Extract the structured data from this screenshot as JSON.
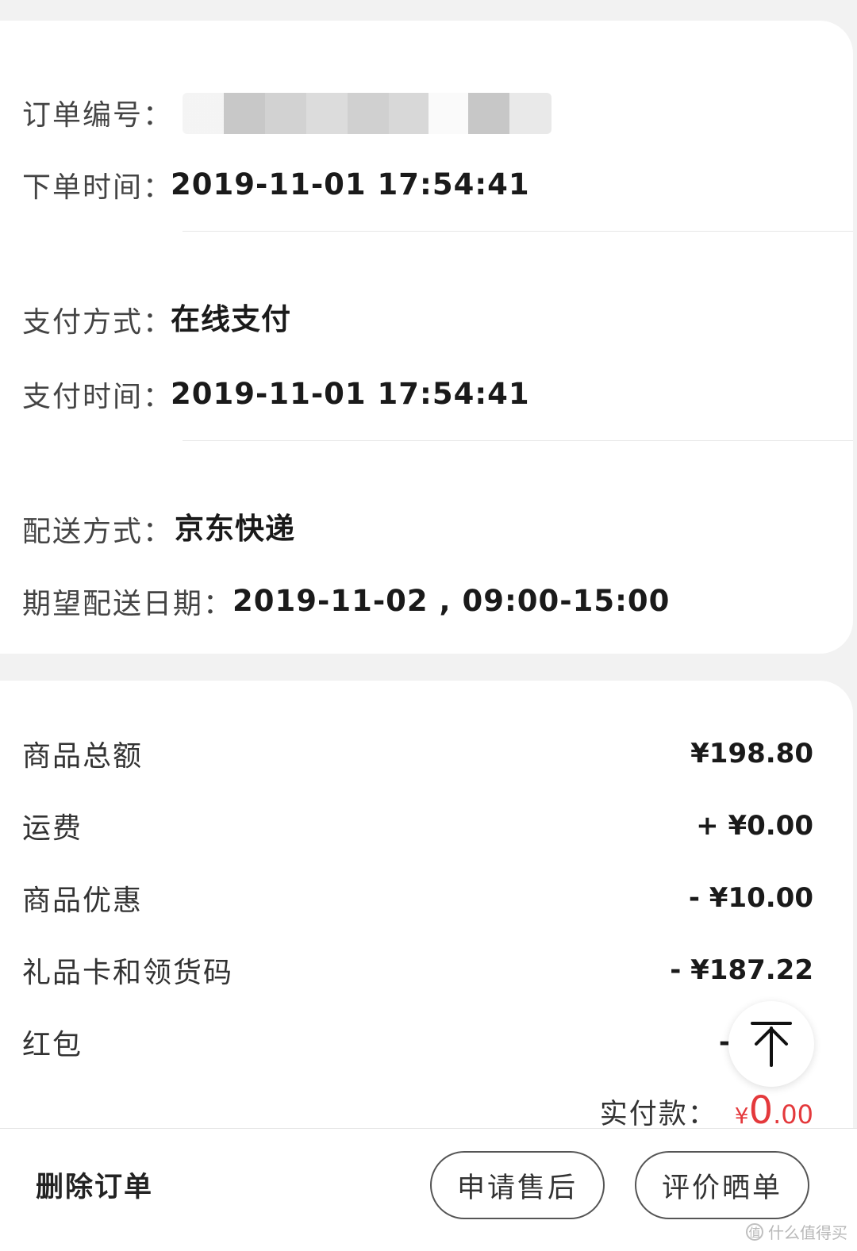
{
  "order_info": {
    "order_number_label": "订单编号：",
    "order_time_label": "下单时间：",
    "order_time_value": "2019-11-01 17:54:41",
    "payment_method_label": "支付方式：",
    "payment_method_value": "在线支付",
    "payment_time_label": "支付时间：",
    "payment_time_value": "2019-11-01 17:54:41",
    "delivery_method_label": "配送方式：",
    "delivery_method_value": "京东快递",
    "expected_delivery_label": "期望配送日期：",
    "expected_delivery_value": "2019-11-02 , 09:00-15:00"
  },
  "price_summary": {
    "items": [
      {
        "label": "商品总额",
        "value": "¥198.80"
      },
      {
        "label": "运费",
        "value": "+ ¥0.00"
      },
      {
        "label": "商品优惠",
        "value": "- ¥10.00"
      },
      {
        "label": "礼品卡和领货码",
        "value": "- ¥187.22"
      },
      {
        "label": "红包",
        "value": "-"
      }
    ],
    "total_label": "实付款：",
    "total_symbol": "¥",
    "total_integer": "0",
    "total_decimal": ".00",
    "accent_color": "#e4393c"
  },
  "floating": {
    "icon": "arrow-up-to-top-icon"
  },
  "actions": {
    "delete_label": "删除订单",
    "after_sale_label": "申请售后",
    "review_label": "评价晒单"
  },
  "watermark": {
    "icon_glyph": "值",
    "text": "什么值得买"
  }
}
